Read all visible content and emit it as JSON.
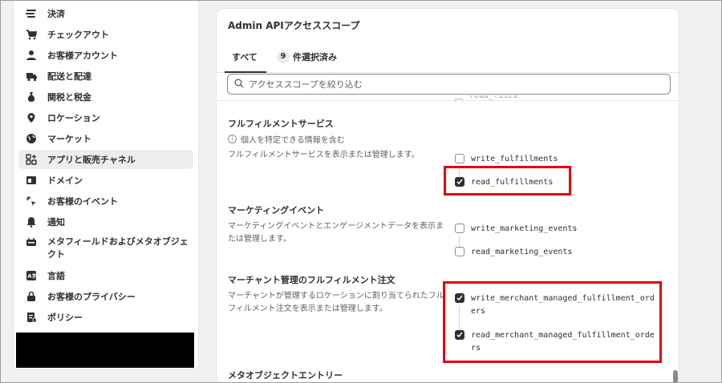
{
  "sidebar": {
    "items": [
      {
        "label": "決済",
        "icon": "payments-icon"
      },
      {
        "label": "チェックアウト",
        "icon": "cart-icon"
      },
      {
        "label": "お客様アカウント",
        "icon": "person-icon"
      },
      {
        "label": "配送と配達",
        "icon": "truck-icon"
      },
      {
        "label": "関税と税金",
        "icon": "money-bag-icon"
      },
      {
        "label": "ロケーション",
        "icon": "location-pin-icon"
      },
      {
        "label": "マーケット",
        "icon": "globe-icon"
      },
      {
        "label": "アプリと販売チャネル",
        "icon": "apps-icon",
        "active": true
      },
      {
        "label": "ドメイン",
        "icon": "domain-icon"
      },
      {
        "label": "お客様のイベント",
        "icon": "sparkle-cursor-icon"
      },
      {
        "label": "通知",
        "icon": "bell-icon"
      },
      {
        "label": "メタフィールドおよびメタオブジェクト",
        "icon": "metafield-icon"
      },
      {
        "label": "言語",
        "icon": "language-icon"
      },
      {
        "label": "お客様のプライバシー",
        "icon": "lock-icon"
      },
      {
        "label": "ポリシー",
        "icon": "policy-icon"
      }
    ]
  },
  "card": {
    "title": "Admin APIアクセススコープ",
    "tabs": {
      "all": "すべて",
      "selected_count": "9",
      "selected_label": "件選択済み"
    },
    "search_placeholder": "アクセススコープを絞り込む",
    "peek_scope": "read_files",
    "sections": [
      {
        "title": "フルフィルメントサービス",
        "note": "個人を特定できる情報を含む",
        "desc": "フルフィルメントサービスを表示または管理します。",
        "scopes": [
          {
            "name": "write_fulfillments",
            "checked": false
          },
          {
            "name": "read_fulfillments",
            "checked": true
          }
        ]
      },
      {
        "title": "マーケティングイベント",
        "desc": "マーケティングイベントとエンゲージメントデータを表示または管理します。",
        "scopes": [
          {
            "name": "write_marketing_events",
            "checked": false
          },
          {
            "name": "read_marketing_events",
            "checked": false
          }
        ]
      },
      {
        "title": "マーチャント管理のフルフィルメント注文",
        "desc": "マーチャントが管理するロケーションに割り当てられたフルフィルメント注文を表示または管理します。",
        "scopes": [
          {
            "name": "write_merchant_managed_fulfillment_orders",
            "checked": true
          },
          {
            "name": "read_merchant_managed_fulfillment_orders",
            "checked": true
          }
        ]
      },
      {
        "title": "メタオブジェクトエントリー"
      }
    ]
  },
  "colors": {
    "highlight": "#e3000f",
    "checkbox_checked": "#303030",
    "redaction": "#000000"
  }
}
